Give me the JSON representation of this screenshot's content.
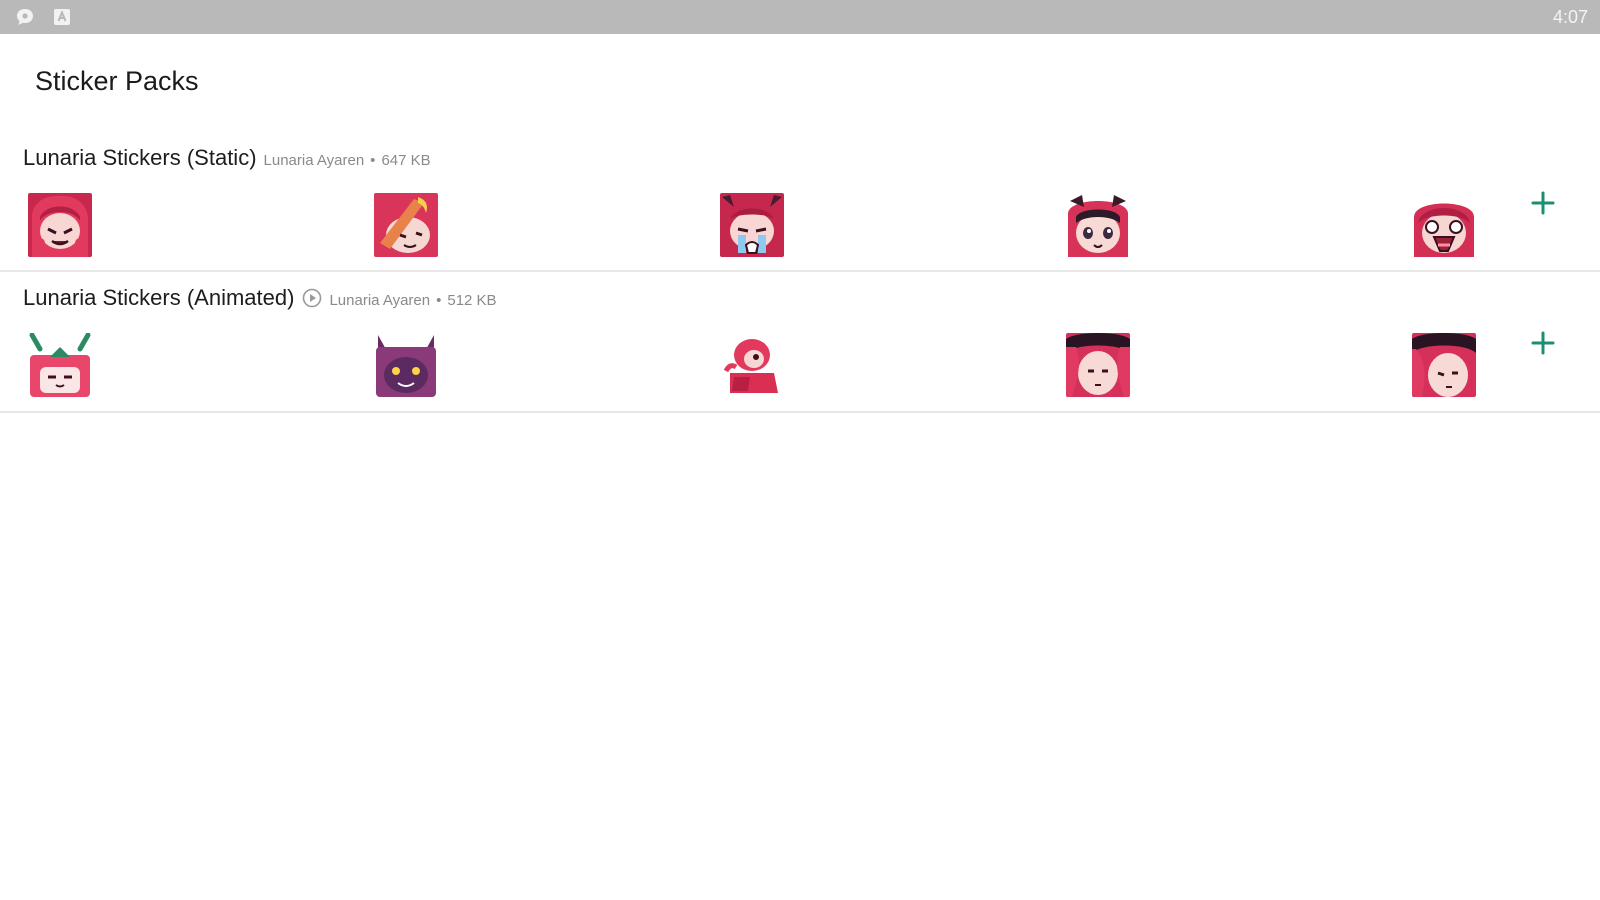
{
  "status_bar": {
    "time": "4:07",
    "icons": [
      "chat-bubble-icon",
      "keyboard-icon"
    ]
  },
  "title": "Sticker Packs",
  "colors": {
    "accent": "#1a8f72",
    "status_bar": "#b9b9b9",
    "divider": "#e7e7e7",
    "meta_text": "#8a8a8a"
  },
  "packs": [
    {
      "name": "Lunaria Stickers (Static)",
      "author": "Lunaria Ayaren",
      "separator": "•",
      "size": "647 KB",
      "animated": false,
      "stickers": [
        "sticker-1",
        "sticker-2",
        "sticker-3",
        "sticker-4",
        "sticker-5"
      ],
      "add_icon": "plus-icon"
    },
    {
      "name": "Lunaria Stickers (Animated)",
      "author": "Lunaria Ayaren",
      "separator": "•",
      "size": "512 KB",
      "animated": true,
      "stickers": [
        "sticker-1",
        "sticker-2",
        "sticker-3",
        "sticker-4",
        "sticker-5"
      ],
      "add_icon": "plus-icon"
    }
  ]
}
